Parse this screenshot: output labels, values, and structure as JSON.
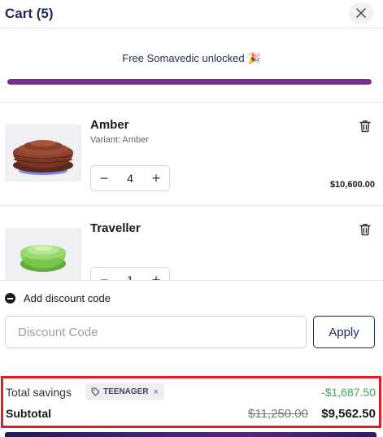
{
  "header": {
    "title": "Cart (5)",
    "close_icon": "close-icon"
  },
  "promo": {
    "message": "Free Somavedic unlocked",
    "emoji": "🎉",
    "progress": 1.0,
    "accent_color": "#7b2c8f"
  },
  "items": [
    {
      "name": "Amber",
      "variant": "Variant: Amber",
      "quantity": "4",
      "minus": "−",
      "plus": "+",
      "price": "$10,600.00",
      "icon": "trash-icon"
    },
    {
      "name": "Traveller",
      "variant": "",
      "quantity": "1",
      "minus": "−",
      "plus": "+",
      "price": "",
      "icon": "trash-icon"
    }
  ],
  "discount": {
    "toggle_label": "Add discount code",
    "input_placeholder": "Discount Code",
    "input_value": "",
    "apply_label": "Apply"
  },
  "summary": {
    "savings_label": "Total savings",
    "code_tag": "TEENAGER",
    "remove_tag": "×",
    "savings_amount": "-$1,687.50",
    "subtotal_label": "Subtotal",
    "original_price": "$11,250.00",
    "final_price": "$9,562.50",
    "savings_color": "#3aaa5a",
    "highlight_color": "#e01b24"
  }
}
